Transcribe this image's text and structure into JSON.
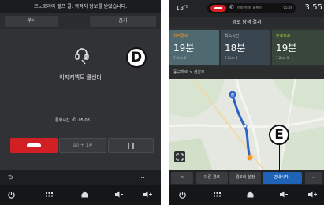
{
  "left_screen": {
    "header_text": "르노코리아 벨프 콜: 목적지 정보를 받았습니다.",
    "ignore_label": "무시",
    "close_label": "끊기",
    "caller_name": "이지커넥트 콜센터",
    "duration_label": "통화시간",
    "duration_value": "05:08",
    "hangup_icon": "phone-hangup-icon",
    "keypad_label": "ab + 1#",
    "pause_icon": "pause-icon",
    "nav_back_icon": "back-arrow-icon",
    "nav_more_label": "...",
    "bottom_icons": [
      "power-icon",
      "menu-grid-icon",
      "home-icon",
      "volume-down-icon",
      "volume-up-icon"
    ]
  },
  "right_screen": {
    "temperature": "13",
    "temperature_unit": "°C",
    "call_bar": {
      "text": "이지커넥트 콜센터",
      "time": "05:08"
    },
    "clock": "3:55",
    "title": "경로 탐색 결과",
    "routes": [
      {
        "label": "최적경로",
        "time": "19분",
        "info": "7.2km 0"
      },
      {
        "label": "최소시간",
        "time": "18분",
        "info": "7.2km 0"
      },
      {
        "label": "무료도로",
        "time": "19분",
        "info": "7.2km 0"
      }
    ],
    "via_text": "동구학로 > 선갑로",
    "buttons": {
      "back_icon": "back-arrow-icon",
      "alt_route_label": "다른 경로",
      "route_settings_label": "경로의 설정",
      "start_label": "안내시작 ·",
      "more_label": "..."
    },
    "map_marker": "출"
  },
  "callouts": {
    "d": "D",
    "e": "E"
  },
  "colors": {
    "hangup_red": "#d21f23",
    "start_blue": "#1e63b5",
    "route_best_orange": "#f29a2e",
    "route_free_green": "#b9d13a",
    "route_line": "#2c63c9"
  }
}
